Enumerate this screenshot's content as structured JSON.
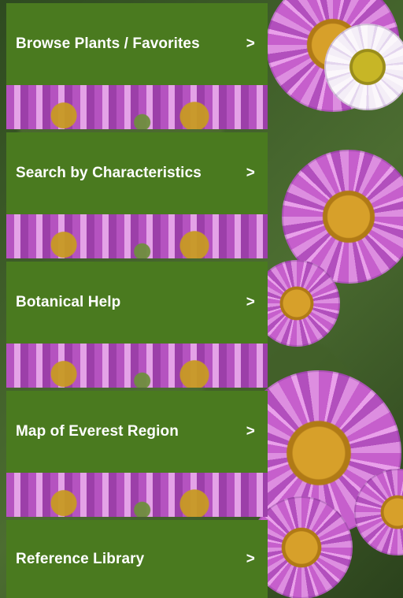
{
  "menu": {
    "items": [
      {
        "label": "Browse Plants / Favorites",
        "chevron": ">"
      },
      {
        "label": "Search by Characteristics",
        "chevron": ">"
      },
      {
        "label": "Botanical Help",
        "chevron": ">"
      },
      {
        "label": "Map of Everest Region",
        "chevron": ">"
      },
      {
        "label": "Reference Library",
        "chevron": ">"
      }
    ]
  },
  "colors": {
    "menu_background": "#4a7a1f",
    "menu_text": "#ffffff",
    "flower_petal": "#c65fcc",
    "flower_center": "#d7a02a"
  },
  "background": {
    "description_icon": "purple-daisy-flowers-photo"
  }
}
